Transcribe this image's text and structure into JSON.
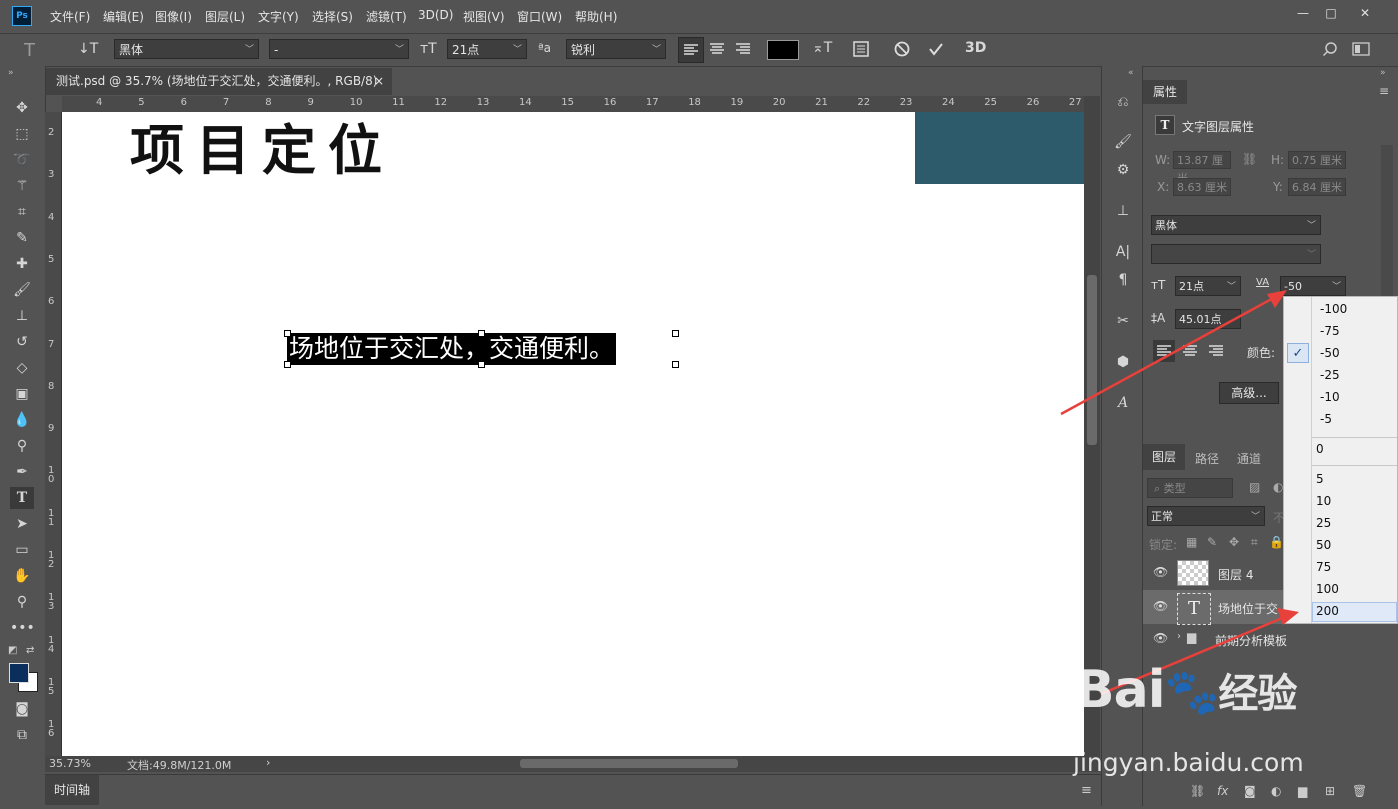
{
  "menubar": {
    "logo": "Ps",
    "items": [
      "文件(F)",
      "编辑(E)",
      "图像(I)",
      "图层(L)",
      "文字(Y)",
      "选择(S)",
      "滤镜(T)",
      "3D(D)",
      "视图(V)",
      "窗口(W)",
      "帮助(H)"
    ],
    "window_buttons": [
      "—",
      "□",
      "✕"
    ]
  },
  "options": {
    "tool_glyph": "T",
    "orient_glyph": "↓T",
    "font_family": "黑体",
    "font_style": "-",
    "size_glyph": "тT",
    "font_size": "21点",
    "aa_glyph": "ªa",
    "antialias": "锐利",
    "text_color": "#000000",
    "warp_glyph": "⌅T",
    "threed_label": "3D"
  },
  "document": {
    "tab_title": "测试.psd @ 35.7% (场地位于交汇处，交通便利。, RGB/8)",
    "tab_close": "×",
    "canvas_title": "项目定位",
    "selected_text": "场地位于交汇处，交通便利。",
    "ruler_h": [
      "4",
      "5",
      "6",
      "7",
      "8",
      "9",
      "10",
      "11",
      "12",
      "13",
      "14",
      "15",
      "16",
      "17",
      "18",
      "19",
      "20",
      "21",
      "22",
      "23",
      "24",
      "25",
      "26",
      "27"
    ],
    "ruler_v": [
      "2",
      "3",
      "4",
      "5",
      "6",
      "7",
      "8",
      "9",
      "1\n0",
      "1\n1",
      "1\n2",
      "1\n3",
      "1\n4",
      "1\n5",
      "1\n6"
    ]
  },
  "status": {
    "zoom": "35.73%",
    "doc_info": "文档:49.8M/121.0M",
    "arrow": "›"
  },
  "timeline": {
    "label": "时间轴"
  },
  "properties": {
    "tab": "属性",
    "header": "文字图层属性",
    "w_label": "W:",
    "w_value": "13.87 厘米",
    "h_label": "H:",
    "h_value": "0.75 厘米",
    "x_label": "X:",
    "x_value": "8.63 厘米",
    "y_label": "Y:",
    "y_value": "6.84 厘米",
    "font_family": "黑体",
    "font_size": "21点",
    "tracking": "-50",
    "leading": "45.01点",
    "color_label": "颜色:",
    "advanced_button": "高级..."
  },
  "layers": {
    "tabs": [
      "图层",
      "路径",
      "通道"
    ],
    "filter_placeholder": "类型",
    "blend_mode": "正常",
    "opacity_partial": "不",
    "lock_label": "锁定:",
    "rows": [
      {
        "name": "图层 4",
        "thumb": "checker"
      },
      {
        "name": "场地位于交",
        "thumb": "T"
      },
      {
        "name": "前期分析模板",
        "thumb": "folder"
      }
    ]
  },
  "tracking_options": {
    "items": [
      "-100",
      "-75",
      "-50",
      "-25",
      "-10",
      "-5",
      "0",
      "5",
      "10",
      "25",
      "50",
      "75",
      "100",
      "200"
    ],
    "selected": "-50",
    "check": "✓"
  },
  "watermark": {
    "brand": "Bai",
    "brand_cn": "经验",
    "url": "jingyan.baidu.com"
  },
  "colors": {
    "canvas_teal": "#2d5b6b",
    "foreground": "#0b2f5c",
    "arrow": "#e8403a"
  }
}
